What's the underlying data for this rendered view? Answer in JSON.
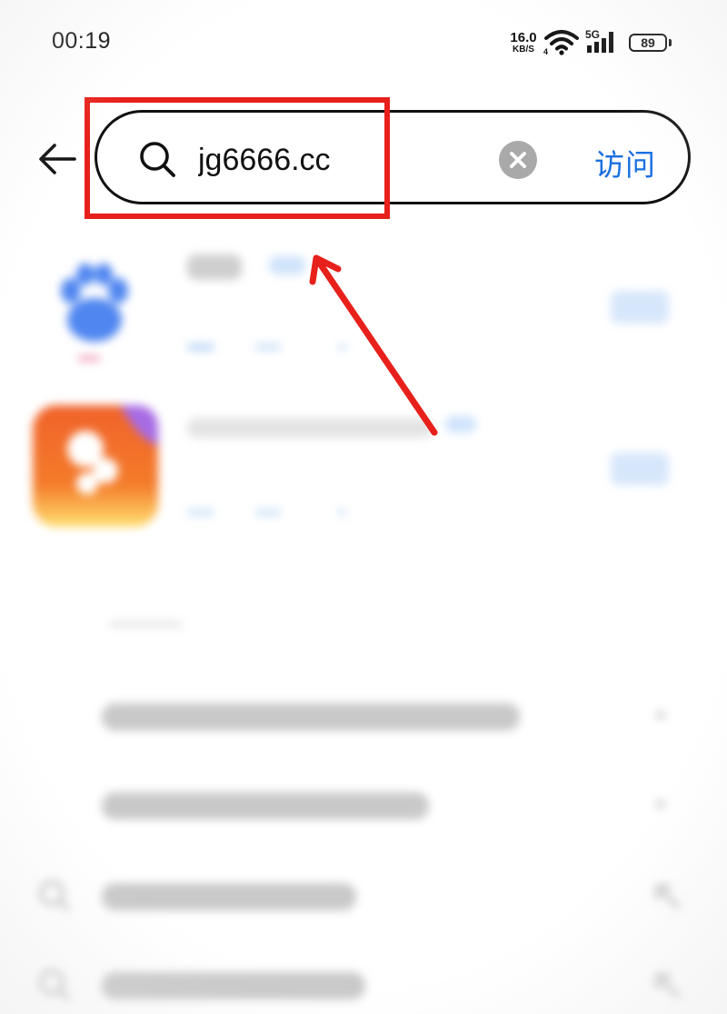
{
  "status_bar": {
    "time": "00:19",
    "net_speed": "16.0",
    "net_speed_unit": "KB/S",
    "network": "5G",
    "wifi_sub": "4",
    "battery": "89"
  },
  "search": {
    "query": "jg6666.cc",
    "visit_label": "访问"
  },
  "colors": {
    "accent": "#1a6fe0",
    "annotation": "#e8201b",
    "clear_button": "#a9a9a9"
  },
  "icons": [
    "back-arrow-icon",
    "search-icon",
    "clear-icon",
    "wifi-icon",
    "cellular-signal-icon",
    "battery-icon",
    "history-search-icon"
  ]
}
